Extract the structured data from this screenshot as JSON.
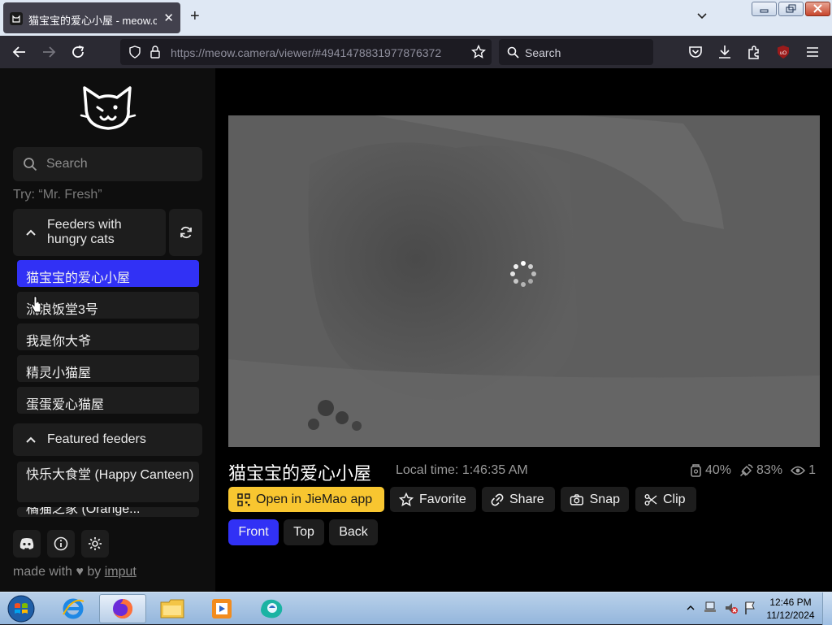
{
  "browser": {
    "tab_title": "猫宝宝的爱心小屋 - meow.camera",
    "url_domain": "https://meow.camera",
    "url_path": "/viewer/#4941478831977876372",
    "search_placeholder": "Search",
    "addon_badge": "uO"
  },
  "sidebar": {
    "search_placeholder": "Search",
    "try_hint": "Try: “Mr. Fresh”",
    "group1_label": "Feeders with hungry cats",
    "feeders": [
      {
        "name": "猫宝宝的爱心小屋",
        "active": true
      },
      {
        "name": "流浪饭堂3号",
        "active": false
      },
      {
        "name": "我是你大爷",
        "active": false
      },
      {
        "name": "精灵小猫屋",
        "active": false
      },
      {
        "name": "蛋蛋爱心猫屋",
        "active": false
      }
    ],
    "group2_label": "Featured feeders",
    "featured": [
      {
        "name": "快乐大食堂 (Happy Canteen)"
      },
      {
        "name": "橘猫之家 (Orange..."
      }
    ],
    "made_with_prefix": "made with",
    "made_with_by": "by",
    "made_with_link": "imput"
  },
  "viewer": {
    "camera_title": "猫宝宝的爱心小屋",
    "local_time": "Local time: 1:46:35 AM",
    "food_level": "40%",
    "signal_level": "83%",
    "viewers": "1",
    "actions": {
      "open_app": "Open in JieMao app",
      "favorite": "Favorite",
      "share": "Share",
      "snap": "Snap",
      "clip": "Clip"
    },
    "views": [
      "Front",
      "Top",
      "Back"
    ],
    "active_view": "Front"
  },
  "taskbar": {
    "time": "12:46 PM",
    "date": "11/12/2024"
  },
  "colors": {
    "accent": "#3131f5",
    "app_button": "#f8c630",
    "panel": "#1d1d1d"
  }
}
